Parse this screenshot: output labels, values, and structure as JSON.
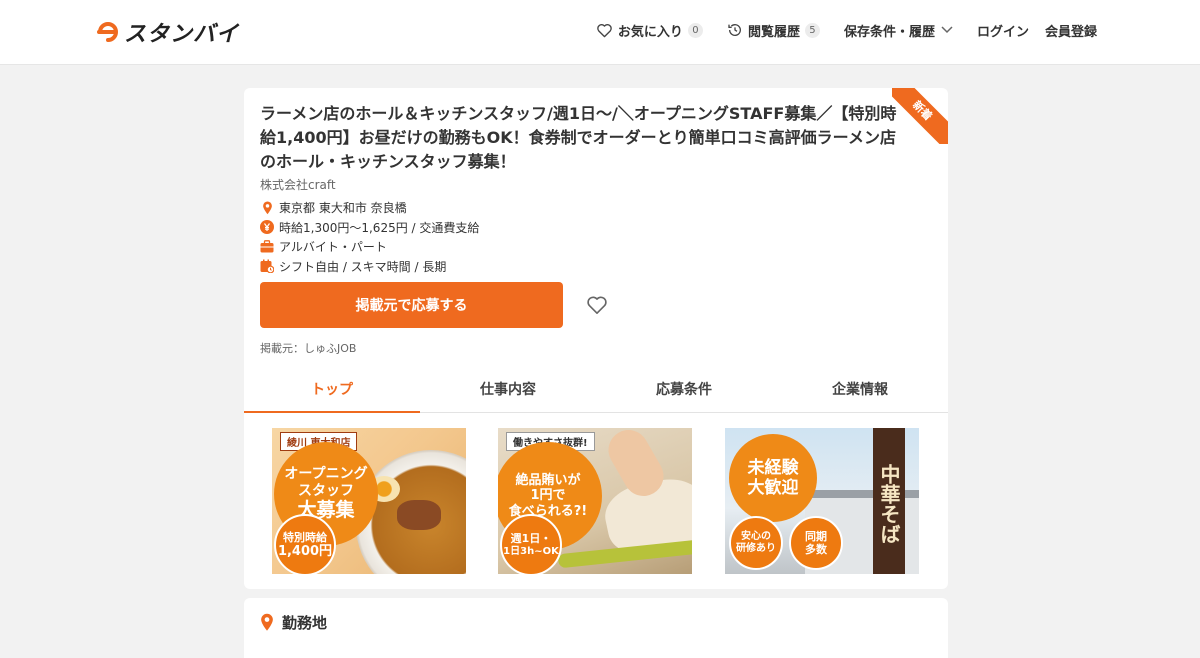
{
  "header": {
    "logo_text": "スタンバイ",
    "nav": {
      "favorites_label": "お気に入り",
      "favorites_count": "0",
      "history_label": "閲覧履歴",
      "history_count": "5",
      "saved_label": "保存条件・履歴",
      "login_label": "ログイン",
      "register_label": "会員登録"
    }
  },
  "job": {
    "badge": "新着",
    "title": "ラーメン店のホール＆キッチンスタッフ/週1日～/＼オープニングSTAFF募集／【特別時給1,400円】お昼だけの勤務もOK！食券制でオーダーとり簡単口コミ高評価ラーメン店のホール・キッチンスタッフ募集！",
    "company": "株式会社craft",
    "location": "東京都 東大和市 奈良橋",
    "salary": "時給1,300円～1,625円 / 交通費支給",
    "employment_type": "アルバイト・パート",
    "shift": "シフト自由 / スキマ時間 / 長期",
    "apply_label": "掲載元で応募する",
    "source": "掲載元：しゅふJOB"
  },
  "tabs": [
    {
      "label": "トップ",
      "active": true
    },
    {
      "label": "仕事内容",
      "active": false
    },
    {
      "label": "応募条件",
      "active": false
    },
    {
      "label": "企業情報",
      "active": false
    }
  ],
  "photos": {
    "p1": {
      "tag": "綾川 東大和店",
      "headline1": "オープニング",
      "headline2": "スタッフ",
      "headline3": "大募集",
      "circle1": "特別時給",
      "circle2": "1,400円"
    },
    "p2": {
      "tag": "働きやすさ抜群!",
      "headline1": "絶品賄いが",
      "headline2": "1円で",
      "headline3": "食べられる?!",
      "circle1": "週1日・",
      "circle2": "1日3h~OK"
    },
    "p3": {
      "headline1": "未経験",
      "headline2": "大歓迎",
      "circle_a1": "安心の",
      "circle_a2": "研修あり",
      "circle_b1": "同期",
      "circle_b2": "多数",
      "sign": "中華そば"
    }
  },
  "section2": {
    "title": "勤務地"
  },
  "colors": {
    "accent": "#ef6a1f",
    "background": "#f2f2f2"
  }
}
